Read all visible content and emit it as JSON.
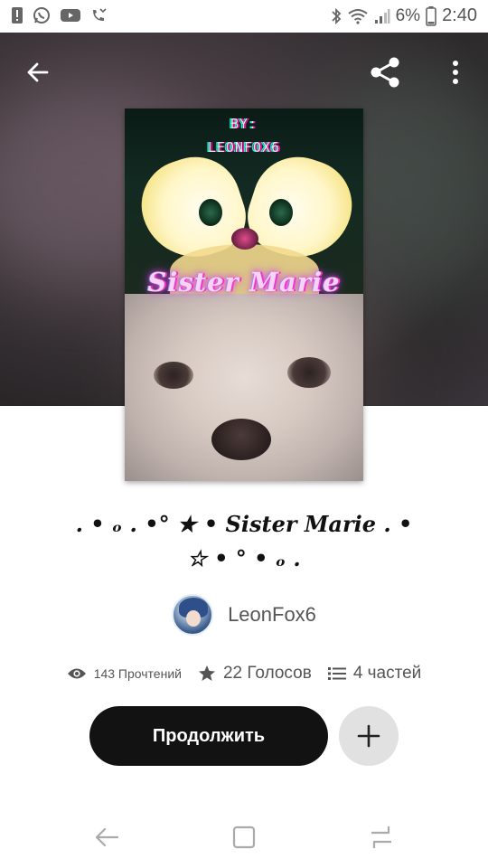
{
  "status_bar": {
    "battery_percent": "6%",
    "time": "2:40",
    "left_icons": [
      "alert-icon",
      "whatsapp-icon",
      "youtube-icon",
      "missed-call-icon"
    ],
    "right_icons": [
      "bluetooth-icon",
      "wifi-icon",
      "signal-icon",
      "battery-icon"
    ]
  },
  "top_bar": {
    "icons": [
      "back-arrow-icon",
      "share-icon",
      "more-vert-icon"
    ]
  },
  "cover": {
    "by": "BY:",
    "author": "LEONFOX6",
    "title": "Sister Marie"
  },
  "story": {
    "title_line1": ". • ₒ . •° ★ • Sister Marie . •",
    "title_line2": "☆ • ° • ₒ ."
  },
  "author": {
    "name": "LeonFox6"
  },
  "stats": {
    "reads": "143 Прочтений",
    "votes": "22 Голосов",
    "parts": "4 частей"
  },
  "actions": {
    "continue_label": "Продолжить",
    "add_icon": "plus-icon"
  },
  "nav_bar": {
    "icons": [
      "nav-back-icon",
      "nav-home-icon",
      "nav-recents-icon"
    ]
  },
  "colors": {
    "button_dark": "#121212",
    "button_light": "#e1e1e1",
    "text_gray": "#555555"
  }
}
